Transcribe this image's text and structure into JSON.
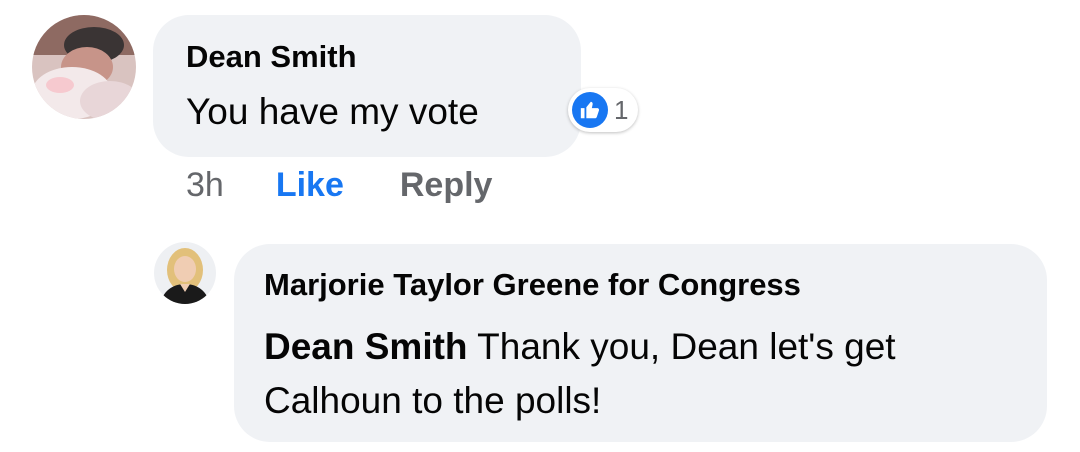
{
  "comment": {
    "author": "Dean Smith",
    "text": "You have my vote",
    "reaction": {
      "icon": "thumbs-up-icon",
      "count": "1",
      "color": "#1877f2"
    },
    "time": "3h",
    "like_label": "Like",
    "reply_label": "Reply"
  },
  "reply": {
    "author": "Marjorie Taylor Greene for Congress",
    "mention": "Dean Smith",
    "text": " Thank you, Dean let's get Calhoun to the polls!"
  }
}
